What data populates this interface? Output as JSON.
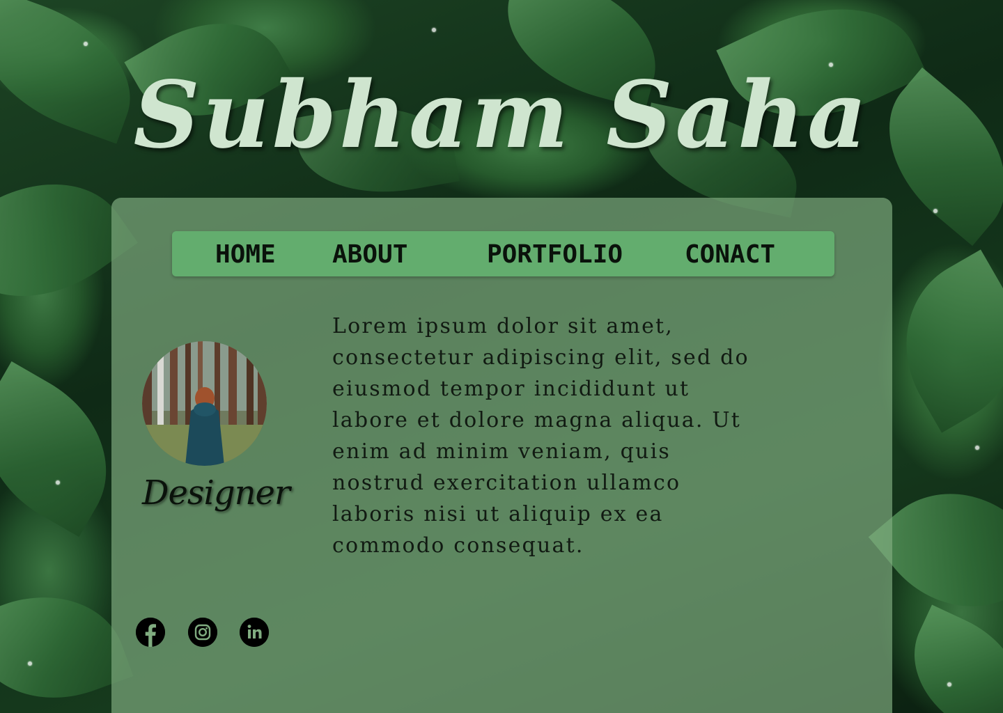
{
  "header": {
    "title": "Subham Saha"
  },
  "nav": {
    "items": [
      {
        "label": "HOME"
      },
      {
        "label": "ABOUT"
      },
      {
        "label": "PORTFOLIO"
      },
      {
        "label": "CONACT"
      }
    ]
  },
  "profile": {
    "role": "Designer",
    "bio": "Lorem ipsum dolor sit amet, consectetur adipiscing elit, sed do eiusmod tempor incididunt ut labore et dolore magna aliqua. Ut enim ad minim veniam, quis nostrud exercitation ullamco laboris nisi ut aliquip ex ea commodo consequat."
  },
  "social": {
    "icons": [
      "facebook-icon",
      "instagram-icon",
      "linkedin-icon"
    ]
  },
  "colors": {
    "card": "#80ac80",
    "navbar": "#63ad6e",
    "title": "#cfe5cf"
  }
}
